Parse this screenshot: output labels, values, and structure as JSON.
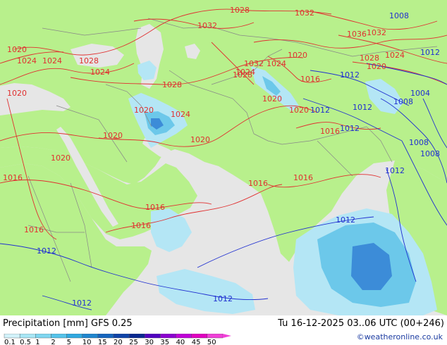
{
  "map": {
    "title": "Precipitation [mm] GFS 0.25",
    "datetime": "Tu 16-12-2025 03..06 UTC (00+246)",
    "credit": "©weatheronline.co.uk",
    "colors": {
      "sea": "#e6e6e6",
      "land": "#b8f08c",
      "isobar_high": "#e03030",
      "isobar_low": "#2030d0",
      "precip_light": "#b4e6f5",
      "precip_mid": "#6cc8ea",
      "precip_heavy": "#3c8cd8"
    },
    "isobar_labels": {
      "l1": "1028",
      "l2": "1032",
      "l3": "1008",
      "l4": "1032",
      "l5": "1036",
      "l6": "1032",
      "l7": "1020",
      "l8": "1024",
      "l9": "1028",
      "l10": "1024",
      "l11": "1020",
      "l12": "1024",
      "l13": "1012",
      "l14": "1028",
      "l15": "1032",
      "l16": "1024",
      "l17": "1016",
      "l18": "1020",
      "l19": "1028",
      "l20": "1024",
      "l21": "1020",
      "l22": "1020",
      "l23": "1024",
      "l24": "1020",
      "l25": "1020",
      "l26": "1016",
      "l27": "1016",
      "l28": "1012",
      "l29": "1020",
      "l30": "1016",
      "l31": "1016",
      "l32": "1016",
      "l33": "1016",
      "l34": "1016",
      "l35": "1012",
      "l36": "1012",
      "l37": "1012",
      "l38": "1012",
      "l39": "1004",
      "l40": "1008",
      "l41": "1008",
      "l42": "1008",
      "l43": "1012",
      "l44": "1012",
      "l45": "1020",
      "l46": "1012",
      "l47": "1012",
      "l48": "1020",
      "l49": "1024",
      "l50": "1028"
    }
  },
  "legend": {
    "ticks": [
      "0.1",
      "0.5",
      "1",
      "2",
      "5",
      "10",
      "15",
      "20",
      "25",
      "30",
      "35",
      "40",
      "45",
      "50"
    ],
    "colors": [
      "#d2f2fa",
      "#a8e6f5",
      "#7fd6f0",
      "#55c3ea",
      "#2fa8e0",
      "#1f86cf",
      "#1565be",
      "#0f44a8",
      "#0a2890",
      "#5000c0",
      "#8c00d0",
      "#c000d8",
      "#e000c0",
      "#f040d8"
    ]
  }
}
